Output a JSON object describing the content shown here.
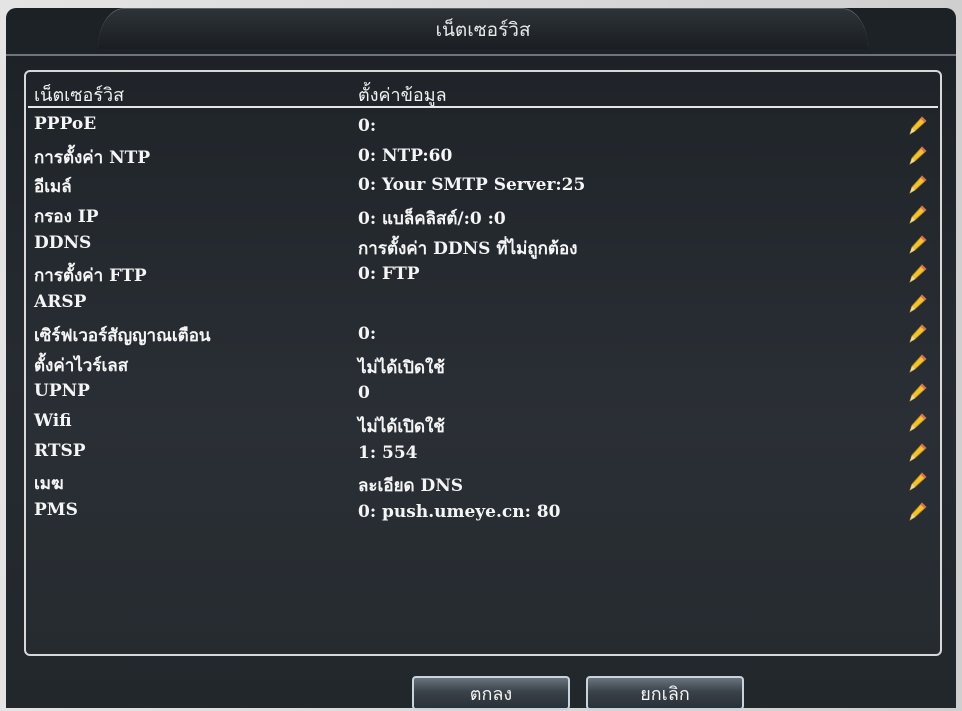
{
  "window": {
    "title": "เน็ตเซอร์วิส"
  },
  "table": {
    "headers": {
      "name": "เน็ตเซอร์วิส",
      "value": "ตั้งค่าข้อมูล"
    },
    "rows": [
      {
        "name": "PPPoE",
        "value": "0:"
      },
      {
        "name": "การตั้งค่า  NTP",
        "value": "0: NTP:60"
      },
      {
        "name": "อีเมล์",
        "value": "0: Your SMTP Server:25"
      },
      {
        "name": "กรอง IP",
        "value": "0: แบล็คลิสต์/:0 :0"
      },
      {
        "name": "DDNS",
        "value": "การตั้งค่า DDNS ที่ไม่ถูกต้อง"
      },
      {
        "name": "การตั้งค่า FTP",
        "value": "0: FTP"
      },
      {
        "name": "ARSP",
        "value": ""
      },
      {
        "name": "เซิร์ฟเวอร์สัญญาณเตือน",
        "value": "0:"
      },
      {
        "name": "ตั้งค่าไวร์เลส",
        "value": "ไม่ได้เปิดใช้"
      },
      {
        "name": "UPNP",
        "value": "0"
      },
      {
        "name": "Wifi",
        "value": "ไม่ได้เปิดใช้"
      },
      {
        "name": "RTSP",
        "value": "1: 554"
      },
      {
        "name": "เมฆ",
        "value": "ละเอียด DNS"
      },
      {
        "name": "PMS",
        "value": "0: push.umeye.cn: 80"
      }
    ],
    "edit_icon": "pencil-icon"
  },
  "buttons": {
    "ok": "ตกลง",
    "cancel": "ยกเลิก"
  },
  "colors": {
    "background": "#22272c",
    "text": "#f5f5f5",
    "border": "#d8d8d8",
    "pencil": "#f2c230"
  }
}
